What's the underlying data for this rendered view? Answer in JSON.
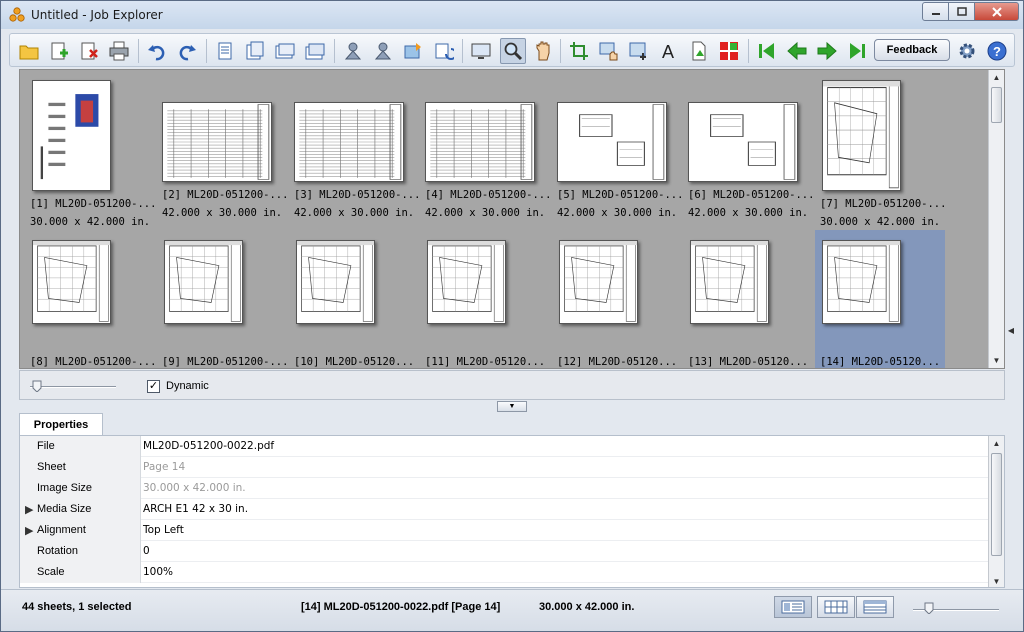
{
  "window": {
    "title": "Untitled - Job Explorer"
  },
  "toolbar": {
    "feedback_label": "Feedback"
  },
  "thumbnails": [
    {
      "name": "[1] ML20D-051200-...",
      "size": "30.000 x 42.000 in.",
      "orientation": "portrait",
      "selected": false
    },
    {
      "name": "[2] ML20D-051200-...",
      "size": "42.000 x 30.000 in.",
      "orientation": "landscape",
      "selected": false
    },
    {
      "name": "[3] ML20D-051200-...",
      "size": "42.000 x 30.000 in.",
      "orientation": "landscape",
      "selected": false
    },
    {
      "name": "[4] ML20D-051200-...",
      "size": "42.000 x 30.000 in.",
      "orientation": "landscape",
      "selected": false
    },
    {
      "name": "[5] ML20D-051200-...",
      "size": "42.000 x 30.000 in.",
      "orientation": "landscape",
      "selected": false
    },
    {
      "name": "[6] ML20D-051200-...",
      "size": "42.000 x 30.000 in.",
      "orientation": "landscape",
      "selected": false
    },
    {
      "name": "[7] ML20D-051200-...",
      "size": "30.000 x 42.000 in.",
      "orientation": "portrait",
      "selected": false
    },
    {
      "name": "[8] ML20D-051200-...",
      "size": "",
      "orientation": "portrait",
      "selected": false
    },
    {
      "name": "[9] ML20D-051200-...",
      "size": "",
      "orientation": "portrait",
      "selected": false
    },
    {
      "name": "[10] ML20D-05120...",
      "size": "",
      "orientation": "portrait",
      "selected": false
    },
    {
      "name": "[11] ML20D-05120...",
      "size": "",
      "orientation": "portrait",
      "selected": false
    },
    {
      "name": "[12] ML20D-05120...",
      "size": "",
      "orientation": "portrait",
      "selected": false
    },
    {
      "name": "[13] ML20D-05120...",
      "size": "",
      "orientation": "portrait",
      "selected": false
    },
    {
      "name": "[14] ML20D-05120...",
      "size": "",
      "orientation": "portrait",
      "selected": true
    }
  ],
  "zoom_bar": {
    "dynamic_label": "Dynamic",
    "dynamic_checked": "✓"
  },
  "properties": {
    "tab_label": "Properties",
    "rows": [
      {
        "key": "File",
        "value": "ML20D-051200-0022.pdf",
        "dim": false,
        "expandable": false
      },
      {
        "key": "Sheet",
        "value": "Page 14",
        "dim": true,
        "expandable": false
      },
      {
        "key": "Image Size",
        "value": "30.000 x 42.000 in.",
        "dim": true,
        "expandable": false
      },
      {
        "key": "Media Size",
        "value": "ARCH E1 42 x 30 in.",
        "dim": false,
        "expandable": true
      },
      {
        "key": "Alignment",
        "value": "Top Left",
        "dim": false,
        "expandable": true
      },
      {
        "key": "Rotation",
        "value": "0",
        "dim": false,
        "expandable": false
      },
      {
        "key": "Scale",
        "value": "100%",
        "dim": false,
        "expandable": false
      }
    ]
  },
  "status": {
    "sheets": "44 sheets, 1 selected",
    "selected_file": "[14] ML20D-051200-0022.pdf [Page 14]",
    "selected_size": "30.000 x 42.000 in."
  },
  "colors": {
    "selection": "#8397bb",
    "thumb_bg": "#a6a6a6",
    "accent_green": "#2fa52b",
    "help_blue": "#3a6fd1"
  }
}
